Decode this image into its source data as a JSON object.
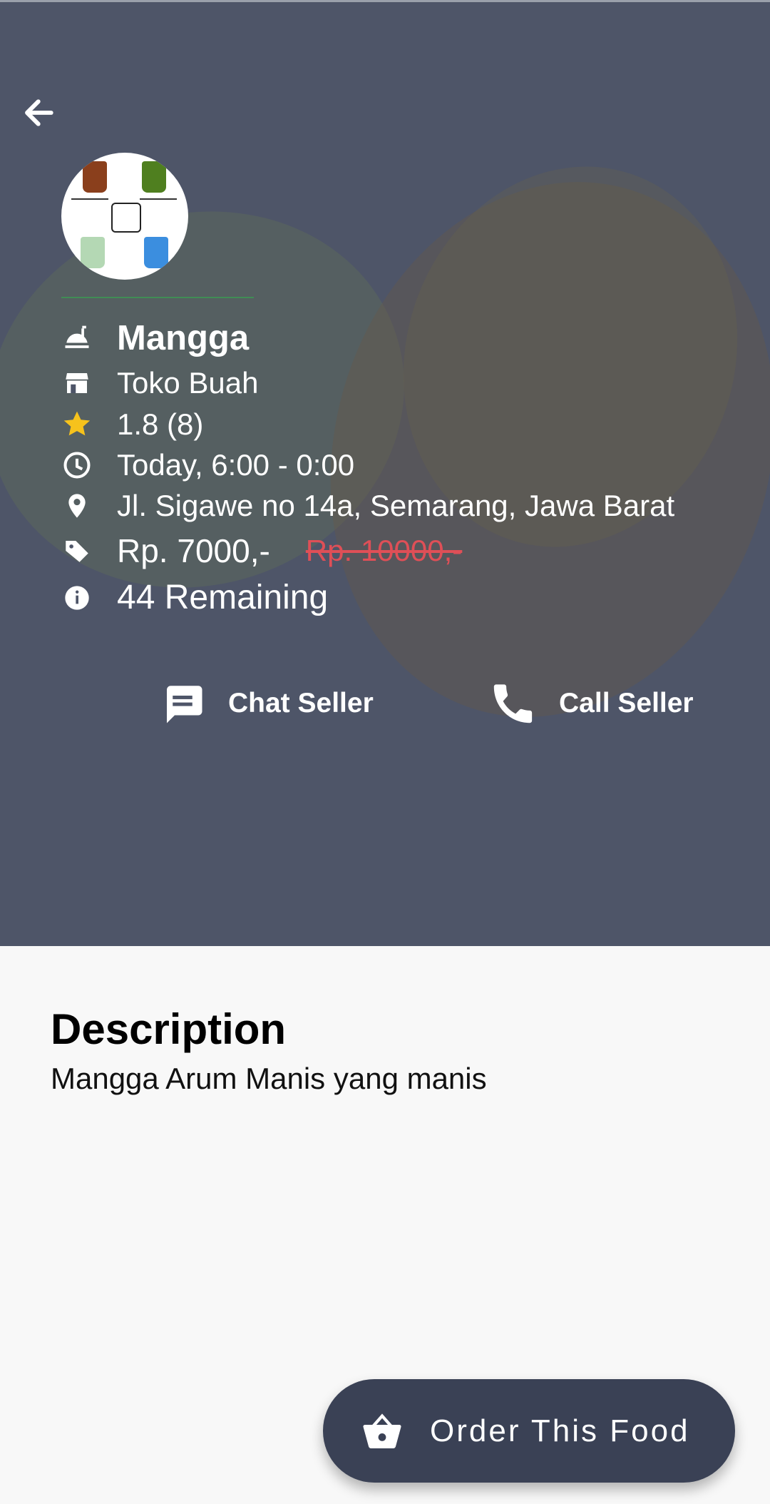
{
  "product": {
    "name": "Mangga",
    "store": "Toko Buah",
    "rating": "1.8 (8)",
    "hours": "Today, 6:00 - 0:00",
    "address": "Jl. Sigawe no 14a, Semarang, Jawa Barat",
    "price": "Rp. 7000,-",
    "old_price": "Rp. 10000,-",
    "remaining": "44 Remaining"
  },
  "actions": {
    "chat_label": "Chat Seller",
    "call_label": "Call Seller"
  },
  "description": {
    "title": "Description",
    "text": "Mangga Arum Manis yang manis"
  },
  "order": {
    "label": "Order This Food"
  },
  "icons": {
    "back": "arrow-left-icon",
    "food": "food-icon",
    "store": "store-icon",
    "rating": "star-icon",
    "hours": "clock-icon",
    "address": "location-pin-icon",
    "price": "tag-icon",
    "remaining": "info-icon",
    "chat": "chat-icon",
    "call": "phone-icon",
    "order": "basket-icon"
  },
  "colors": {
    "hero": "#4e5568",
    "star": "#f6c21c",
    "old_price": "#df4f57",
    "order_button": "#3a4155",
    "divider": "#3f8f54"
  }
}
